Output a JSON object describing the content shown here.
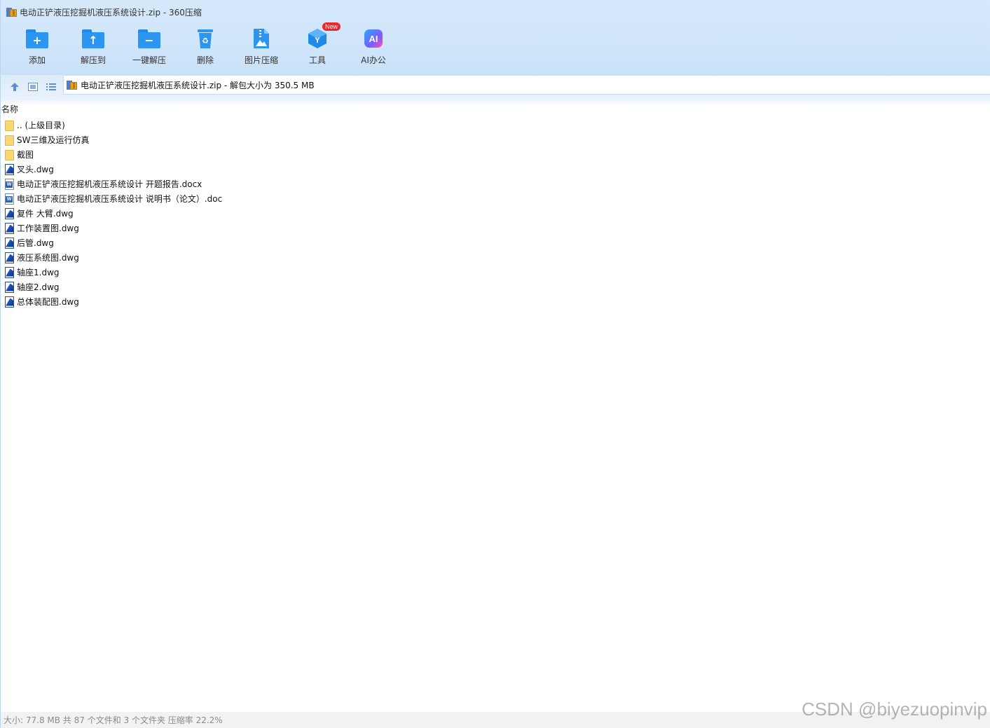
{
  "window": {
    "title": "电动正铲液压挖掘机液压系统设计.zip - 360压缩"
  },
  "toolbar": {
    "items": [
      {
        "label": "添加",
        "icon": "add-folder-icon",
        "symbol": "+"
      },
      {
        "label": "解压到",
        "icon": "extract-to-icon",
        "symbol": "↑"
      },
      {
        "label": "一键解压",
        "icon": "one-click-extract-icon",
        "symbol": "−"
      },
      {
        "label": "删除",
        "icon": "recycle-bin-icon",
        "symbol": "♻"
      },
      {
        "label": "图片压缩",
        "icon": "image-compress-icon",
        "symbol": "▲"
      },
      {
        "label": "工具",
        "icon": "tools-icon",
        "symbol": "Y",
        "badge": "New"
      },
      {
        "label": "AI办公",
        "icon": "ai-office-icon",
        "symbol": "AI"
      }
    ]
  },
  "nav": {
    "address": "电动正铲液压挖掘机液压系统设计.zip - 解包大小为 350.5 MB",
    "up_icon": "up-arrow-icon",
    "thumbnail_icon": "thumbnail-view-icon",
    "list_icon": "list-view-icon"
  },
  "list": {
    "column_name": "名称",
    "files": [
      {
        "name": ".. (上级目录)",
        "type": "folder"
      },
      {
        "name": "SW三维及运行仿真",
        "type": "folder"
      },
      {
        "name": "截图",
        "type": "folder"
      },
      {
        "name": "叉头.dwg",
        "type": "dwg"
      },
      {
        "name": "电动正铲液压挖掘机液压系统设计 开题报告.docx",
        "type": "doc"
      },
      {
        "name": "电动正铲液压挖掘机液压系统设计 说明书（论文）.doc",
        "type": "doc"
      },
      {
        "name": "复件 大臂.dwg",
        "type": "dwg"
      },
      {
        "name": "工作装置图.dwg",
        "type": "dwg"
      },
      {
        "name": "后管.dwg",
        "type": "dwg"
      },
      {
        "name": "液压系统图.dwg",
        "type": "dwg"
      },
      {
        "name": "轴座1.dwg",
        "type": "dwg"
      },
      {
        "name": "轴座2.dwg",
        "type": "dwg"
      },
      {
        "name": "总体装配图.dwg",
        "type": "dwg"
      }
    ]
  },
  "status": {
    "text": "大小: 77.8 MB 共 87 个文件和 3 个文件夹 压缩率 22.2%"
  },
  "watermark": "CSDN @biyezuopinvip",
  "colors": {
    "accent": "#2b95ef",
    "toolbar_bg": "#d6e9fb",
    "badge": "#e8292c"
  }
}
